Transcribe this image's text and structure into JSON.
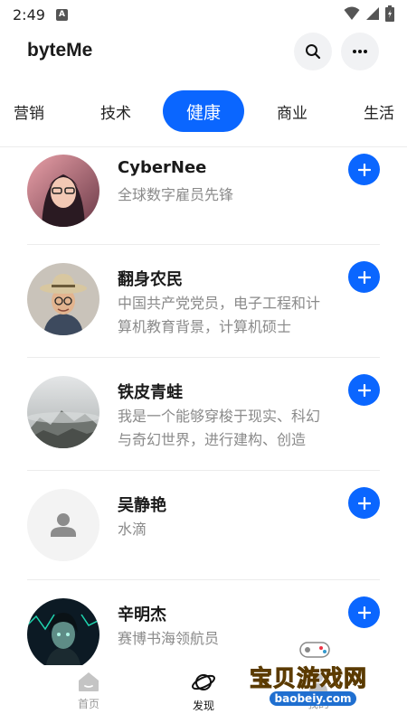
{
  "status_bar": {
    "time": "2:49",
    "notification_letter": "A"
  },
  "header": {
    "title": "byteMe"
  },
  "tabs": [
    {
      "label": "营销",
      "active": false
    },
    {
      "label": "技术",
      "active": false
    },
    {
      "label": "健康",
      "active": true
    },
    {
      "label": "商业",
      "active": false
    },
    {
      "label": "生活",
      "active": false
    }
  ],
  "users": [
    {
      "name": "CyberNee",
      "description": "全球数字雇员先锋",
      "avatar": "woman-with-glasses"
    },
    {
      "name": "翻身农民",
      "description": "中国共产党党员，电子工程和计算机教育背景，计算机硕士",
      "avatar": "man-with-hat"
    },
    {
      "name": "铁皮青蛙",
      "description": "我是一个能够穿梭于现实、科幻与奇幻世界，进行建构、创造",
      "avatar": "misty-mountain"
    },
    {
      "name": "吴静艳",
      "description": "水滴",
      "avatar": "default-person"
    },
    {
      "name": "辛明杰",
      "description": "赛博书海领航员",
      "avatar": "cyber-portrait"
    }
  ],
  "bottom_nav": [
    {
      "label": "首页",
      "icon": "home-icon",
      "active": false
    },
    {
      "label": "发现",
      "icon": "planet-icon",
      "active": true
    },
    {
      "label": "我的",
      "icon": "profile-icon",
      "active": false
    }
  ],
  "watermark": {
    "text": "宝贝游戏网",
    "url": "baobeiy.com"
  },
  "colors": {
    "accent": "#0a66ff",
    "muted_text": "#8a8a8a",
    "divider": "#ececec"
  }
}
